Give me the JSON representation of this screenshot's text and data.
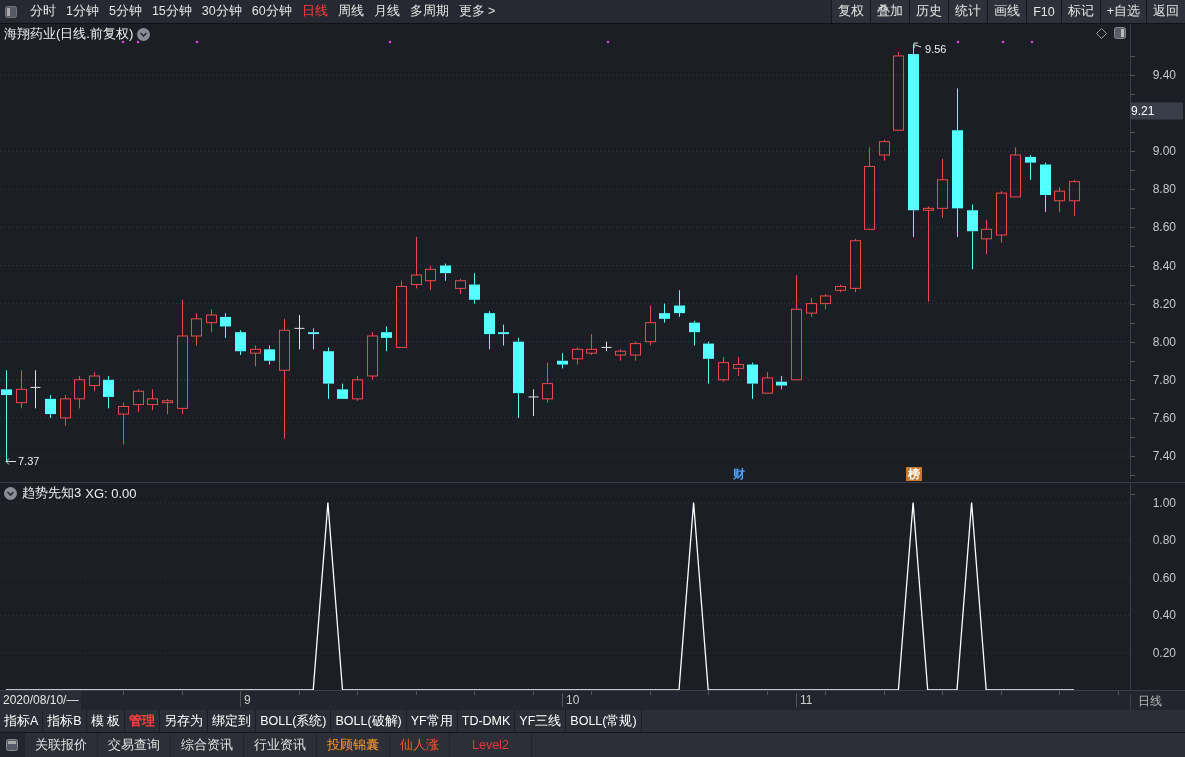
{
  "toolbar": {
    "periods": [
      {
        "label": "分时",
        "selected": false
      },
      {
        "label": "1分钟",
        "selected": false
      },
      {
        "label": "5分钟",
        "selected": false
      },
      {
        "label": "15分钟",
        "selected": false
      },
      {
        "label": "30分钟",
        "selected": false
      },
      {
        "label": "60分钟",
        "selected": false
      },
      {
        "label": "日线",
        "selected": true
      },
      {
        "label": "周线",
        "selected": false
      },
      {
        "label": "月线",
        "selected": false
      },
      {
        "label": "多周期",
        "selected": false
      },
      {
        "label": "更多 >",
        "selected": false
      }
    ],
    "buttons": [
      "复权",
      "叠加",
      "历史",
      "统计",
      "画线",
      "F10",
      "标记",
      "+自选",
      "返回"
    ]
  },
  "price_chart": {
    "title": "海翔药业(日线.前复权)",
    "high_label": "9.56",
    "low_label": "7.37",
    "price_axis": [
      "9.40",
      "9.00",
      "8.80",
      "8.60",
      "8.40",
      "8.20",
      "8.00",
      "7.80",
      "7.60",
      "7.40"
    ],
    "current_price": "9.21",
    "markers": [
      {
        "label": "财",
        "color": "#4fa3ff"
      },
      {
        "label": "榜",
        "color": "#c8782a"
      }
    ]
  },
  "indicator": {
    "title": "趋势先知3",
    "value_text": ": 0.00",
    "chart_data": {
      "type": "line",
      "grid": true,
      "series": [
        {
          "name": "XG",
          "color": "#ffffff",
          "values": [
            0,
            0,
            0,
            0,
            0,
            0,
            0,
            0,
            0,
            0,
            0,
            0,
            0,
            0,
            0,
            0,
            0,
            0,
            0,
            0,
            0,
            0,
            1,
            0,
            0,
            0,
            0,
            0,
            0,
            0,
            0,
            0,
            0,
            0,
            0,
            0,
            0,
            0,
            0,
            0,
            0,
            0,
            0,
            0,
            0,
            0,
            0,
            1,
            0,
            0,
            0,
            0,
            0,
            0,
            0,
            0,
            0,
            0,
            0,
            0,
            0,
            0,
            1,
            0,
            0,
            0,
            1,
            0,
            0,
            0,
            0,
            0,
            0,
            0
          ]
        }
      ],
      "ylim": [
        0,
        1.104
      ],
      "yticks": [
        {
          "value": 0.2,
          "label": "0.20"
        },
        {
          "value": 0.4,
          "label": "0.40"
        },
        {
          "value": 0.6,
          "label": "0.60"
        },
        {
          "value": 0.8,
          "label": "0.80"
        },
        {
          "value": 1,
          "label": "1.00"
        }
      ]
    }
  },
  "date_axis": {
    "start": "2020/08/10/—",
    "months": [
      "9",
      "10",
      "11"
    ],
    "period_label": "日线"
  },
  "indicator_tabs": [
    {
      "label": "指标A",
      "color": "#ffffff"
    },
    {
      "label": "指标B",
      "color": "#ffffff"
    },
    {
      "label": "模 板",
      "color": "#ffffff"
    },
    {
      "label": "管理",
      "color": "#ff4040"
    },
    {
      "label": "另存为",
      "color": "#ffffff"
    },
    {
      "label": "绑定到",
      "color": "#ffffff"
    },
    {
      "label": "BOLL(系统)",
      "color": "#ffffff"
    },
    {
      "label": "BOLL(破解)",
      "color": "#ffffff"
    },
    {
      "label": "YF常用",
      "color": "#ffffff"
    },
    {
      "label": "TD-DMK",
      "color": "#ffffff"
    },
    {
      "label": "YF三线",
      "color": "#ffffff"
    },
    {
      "label": "BOLL(常规)",
      "color": "#ffffff"
    }
  ],
  "bottom_tabs": [
    {
      "label": "关联报价",
      "color": "#e0e0e0"
    },
    {
      "label": "交易查询",
      "color": "#e0e0e0"
    },
    {
      "label": "综合资讯",
      "color": "#e0e0e0"
    },
    {
      "label": "行业资讯",
      "color": "#e0e0e0"
    },
    {
      "label": "投顾锦囊",
      "color": "#ff9a2e"
    },
    {
      "label": "仙人涨",
      "color": "#ff5a28"
    },
    {
      "label": "Level2",
      "color": "#e83a3a"
    }
  ]
}
